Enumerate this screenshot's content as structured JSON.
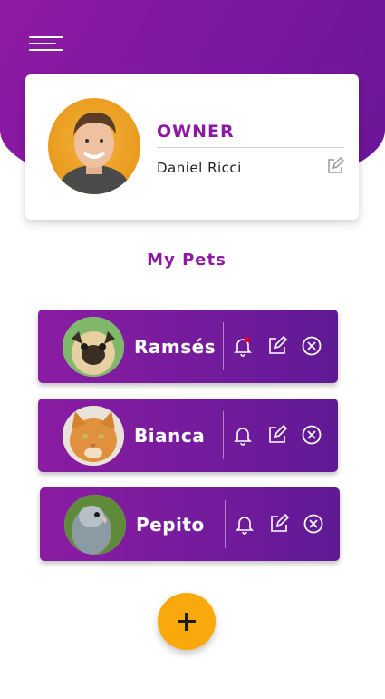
{
  "owner": {
    "role": "OWNER",
    "name": "Daniel Ricci",
    "avatar_icon": "owner-photo"
  },
  "section": {
    "title": "My Pets"
  },
  "pets": [
    {
      "name": "Ramsés",
      "photo": "pug-photo",
      "notification_dot": true
    },
    {
      "name": "Bianca",
      "photo": "orange-cat-photo",
      "notification_dot": false
    },
    {
      "name": "Pepito",
      "photo": "parrot-photo",
      "notification_dot": false
    }
  ],
  "colors": {
    "brand": "#8e1aa3",
    "card_gradient_end": "#5f1a94",
    "fab": "#f9a90c",
    "alert_dot": "#e3001b"
  },
  "icons": {
    "menu": "menu-icon",
    "edit": "edit-icon",
    "bell": "bell-icon",
    "remove": "close-circle-icon",
    "add": "plus-icon"
  }
}
